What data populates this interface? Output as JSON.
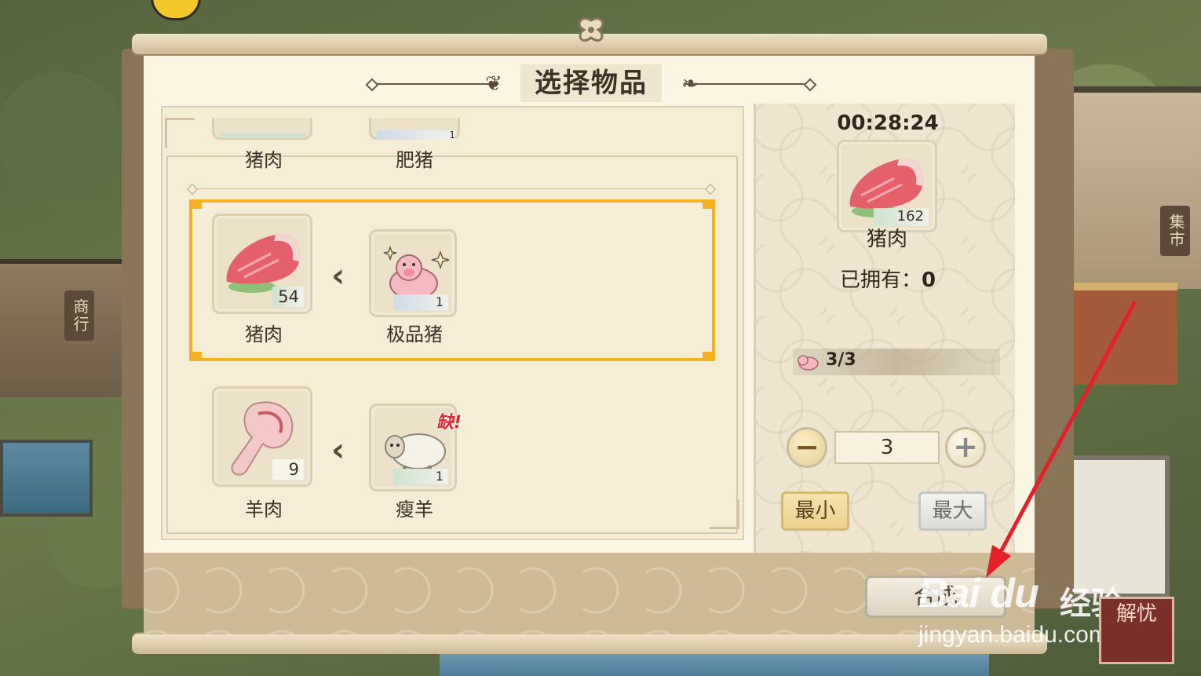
{
  "hud": {
    "coin_label": ""
  },
  "side_tags": {
    "left": "商行",
    "right": "集市"
  },
  "dialog": {
    "title": "选择物品",
    "list": {
      "partial_row": {
        "output": {
          "name": "猪肉",
          "icon": "pork-icon"
        },
        "input": {
          "name": "肥猪",
          "count": "1",
          "icon": "pig-icon"
        }
      },
      "rows": [
        {
          "selected": true,
          "output": {
            "name": "猪肉",
            "count": "54",
            "icon": "pork-icon"
          },
          "input": {
            "name": "极品猪",
            "count": "1",
            "icon": "premium-pig-icon"
          }
        },
        {
          "selected": false,
          "output": {
            "name": "羊肉",
            "count": "9",
            "icon": "mutton-icon"
          },
          "input": {
            "name": "瘦羊",
            "count": "1",
            "icon": "sheep-icon",
            "badge": "缺!"
          }
        }
      ]
    },
    "detail": {
      "timer": "00:28:24",
      "item": {
        "name": "猪肉",
        "count": "162",
        "icon": "pork-icon"
      },
      "owned_label": "已拥有：",
      "owned_value": "0",
      "capacity": "3/3",
      "quantity": "3",
      "min_label": "最小",
      "max_label": "最大"
    },
    "confirm_label": "合成"
  },
  "watermark": {
    "logo": "Bai du",
    "cn": "经验",
    "url": "jingyan.baidu.com"
  },
  "seal_text": "解忧",
  "colors": {
    "selection": "#f4b223",
    "arrow": "#e5202a",
    "panel": "#fbf5e3"
  }
}
